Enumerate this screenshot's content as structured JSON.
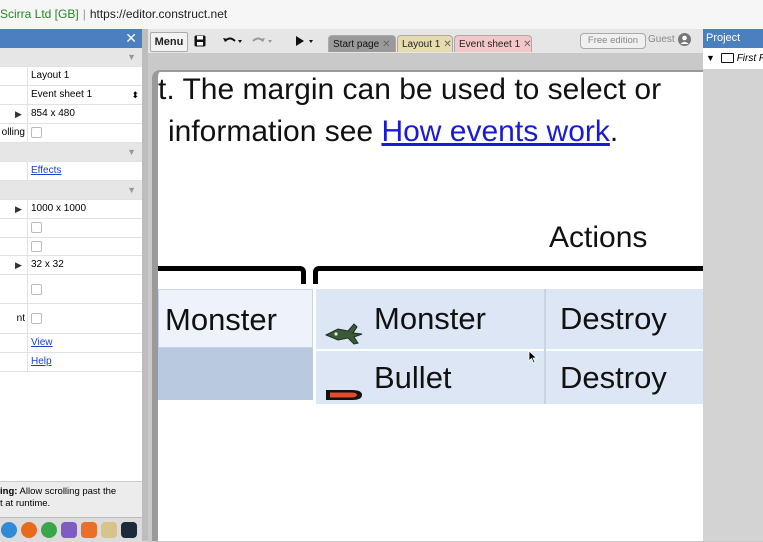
{
  "browser": {
    "cert_label": "Scirra Ltd [GB]",
    "url": "https://editor.construct.net"
  },
  "properties_panel": {
    "close_glyph": "✕",
    "rows": [
      {
        "key": "",
        "value": "Layout 1"
      },
      {
        "key": "",
        "value": "Event sheet 1"
      },
      {
        "key": "",
        "value": "854 x 480"
      },
      {
        "key": "olling",
        "value": ""
      },
      {
        "key": "",
        "value": "Effects"
      },
      {
        "key": "",
        "value": "1000 x 1000"
      },
      {
        "key": "",
        "value": "32 x 32"
      },
      {
        "key": "nt",
        "value": ""
      },
      {
        "key": "",
        "value": "View"
      },
      {
        "key": "",
        "value": "Help"
      }
    ],
    "help_bold": "ing:",
    "help_text": " Allow scrolling past the",
    "help_text2": "t at runtime."
  },
  "toolbar": {
    "menu_label": "Menu",
    "tabs": [
      {
        "label": "Start page",
        "close": "✕"
      },
      {
        "label": "Layout 1",
        "close": "✕"
      },
      {
        "label": "Event sheet 1",
        "close": "✕"
      }
    ],
    "free_edition_label": "Free edition",
    "guest_label": "Guest"
  },
  "project_panel": {
    "title": "Project",
    "root_item": "First P"
  },
  "event_sheet": {
    "intro_line1": "t. The margin can be used to select or",
    "intro_line2_prefix": "information see ",
    "intro_link": "How events work",
    "intro_line2_suffix": ".",
    "actions_header": "Actions",
    "condition_object": "Monster",
    "actions": [
      {
        "object": "Monster",
        "action": "Destroy",
        "icon": "monster-icon"
      },
      {
        "object": "Bullet",
        "action": "Destroy",
        "icon": "bullet-icon"
      }
    ]
  }
}
